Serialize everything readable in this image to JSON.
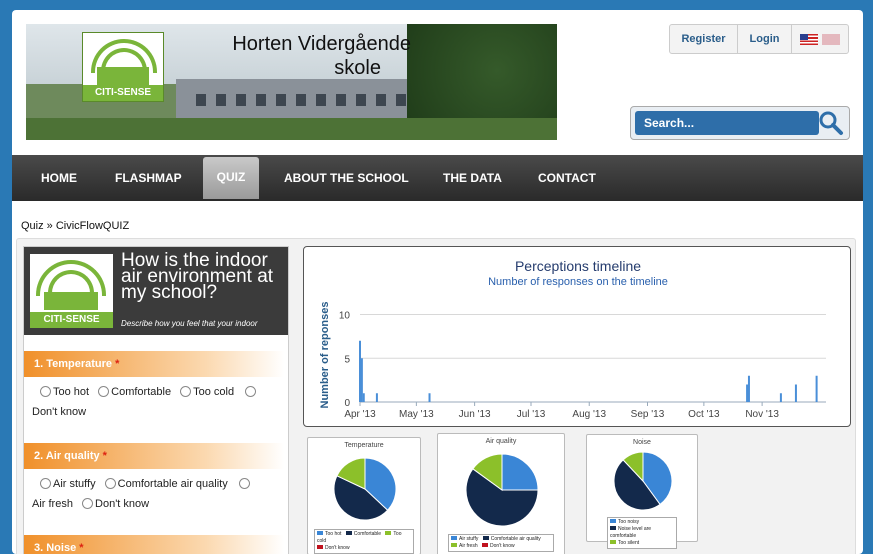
{
  "header": {
    "title_line1": "Horten Vidergående",
    "title_line2": "skole",
    "logo_text": "CITI-SENSE"
  },
  "auth": {
    "register": "Register",
    "login": "Login"
  },
  "search": {
    "placeholder": "Search..."
  },
  "nav": {
    "items": [
      "HOME",
      "FLASHMAP",
      "QUIZ",
      "ABOUT THE SCHOOL",
      "THE DATA",
      "CONTACT"
    ],
    "active": "QUIZ"
  },
  "breadcrumb": "Quiz » CivicFlowQUIZ",
  "quiz": {
    "question": "How is the indoor air environment at my school?",
    "description": "Describe how you feel that your indoor",
    "logo_text": "CITI-SENSE",
    "sections": [
      {
        "label": "1. Temperature",
        "options": [
          "Too hot",
          "Comfortable",
          "Too cold",
          "Don't know"
        ]
      },
      {
        "label": "2. Air quality",
        "options": [
          "Air stuffy",
          "Comfortable air quality",
          "Air fresh",
          "Don't know"
        ]
      },
      {
        "label": "3. Noise",
        "options": []
      }
    ],
    "required_mark": "*"
  },
  "chart_data": [
    {
      "type": "bar",
      "title": "Perceptions timeline",
      "subtitle": "Number of responses on the timeline",
      "ylabel": "Number of reponses",
      "yticks": [
        "0",
        "5",
        "10"
      ],
      "ylim": [
        0,
        12
      ],
      "xticks": [
        "Apr '13",
        "May '13",
        "Jun '13",
        "Jul '13",
        "Aug '13",
        "Sep '13",
        "Oct '13",
        "Nov '13"
      ],
      "x": [
        "2013-04-01",
        "2013-04-02",
        "2013-04-03",
        "2013-04-10",
        "2013-05-08",
        "2013-10-24",
        "2013-10-25",
        "2013-11-11",
        "2013-11-19",
        "2013-11-30"
      ],
      "values": [
        7,
        5,
        1,
        1,
        1,
        2,
        3,
        1,
        2,
        3
      ],
      "color": "#4a8fd8",
      "grid": true
    },
    {
      "type": "pie",
      "title": "Temperature",
      "labels": [
        "Too hot",
        "Comfortable",
        "Too cold",
        "Don't know"
      ],
      "values": [
        37,
        45,
        18,
        0
      ],
      "colors": [
        "#3a86d6",
        "#13294b",
        "#8cc02a",
        "#c0121e"
      ]
    },
    {
      "type": "pie",
      "title": "Air quality",
      "labels": [
        "Air stuffy",
        "Comfortable air quality",
        "Air fresh",
        "Don't know"
      ],
      "values": [
        25,
        60,
        15,
        0
      ],
      "colors": [
        "#3a86d6",
        "#13294b",
        "#8cc02a",
        "#c0121e"
      ]
    },
    {
      "type": "pie",
      "title": "Noise",
      "labels": [
        "Too noisy",
        "Noise level are comfortable",
        "Too silent"
      ],
      "values": [
        40,
        48,
        12
      ],
      "colors": [
        "#3a86d6",
        "#13294b",
        "#8cc02a"
      ]
    }
  ]
}
